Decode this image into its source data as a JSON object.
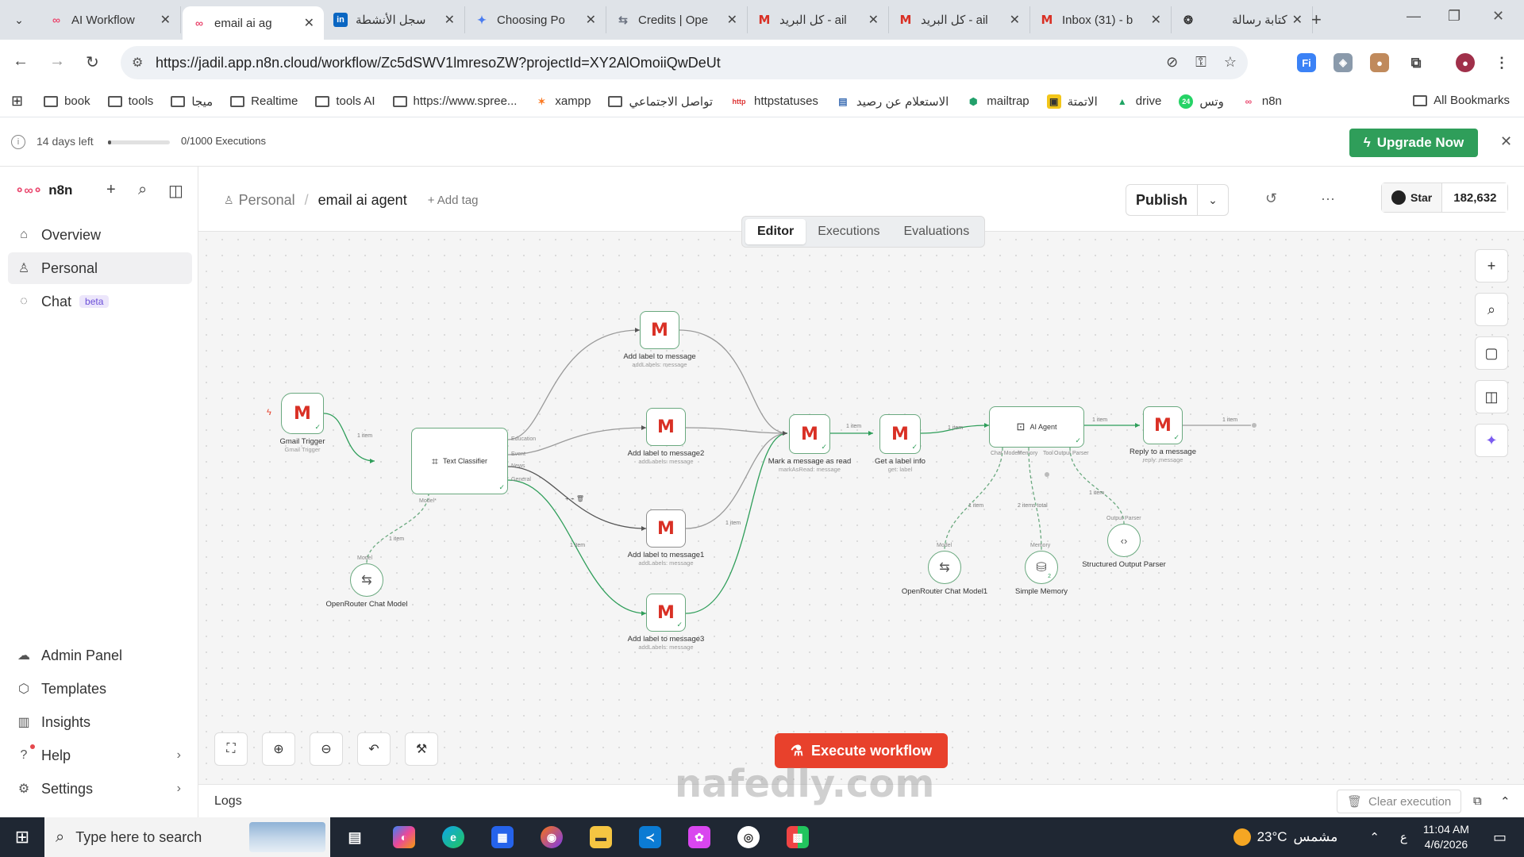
{
  "browser": {
    "tabs": [
      {
        "title": "AI Workflow",
        "icon": "n8n-icon",
        "active": false
      },
      {
        "title": "email ai ag",
        "icon": "n8n-icon",
        "active": true
      },
      {
        "title": "سجل الأنشطة",
        "icon": "linkedin-icon",
        "active": false
      },
      {
        "title": "Choosing Po",
        "icon": "gemini-icon",
        "active": false
      },
      {
        "title": "Credits | Ope",
        "icon": "openrouter-icon",
        "active": false
      },
      {
        "title": "كل البريد - ail",
        "icon": "gmail-icon",
        "active": false
      },
      {
        "title": "كل البريد - ail",
        "icon": "gmail-icon",
        "active": false
      },
      {
        "title": "Inbox (31) - b",
        "icon": "gmail-icon",
        "active": false
      },
      {
        "title": "كتابة رسالة",
        "icon": "chatgpt-icon",
        "active": false
      }
    ],
    "url": "https://jadil.app.n8n.cloud/workflow/Zc5dSWV1lmresoZW?projectId=XY2AlOmoiiQwDeUt",
    "bookmarks": [
      "book",
      "tools",
      "ميجا",
      "Realtime",
      "tools AI",
      "https://www.spree...",
      "xampp",
      "تواصل الاجتماعي",
      "httpstatuses",
      "الاستعلام عن رصيد",
      "mailtrap",
      "الاتمتة",
      "drive",
      "وتس",
      "n8n"
    ],
    "bookmark_icons": {
      "http": "http",
      "wts": "24"
    },
    "all_bookmarks": "All Bookmarks"
  },
  "trial": {
    "days_left": "14 days left",
    "progress": 0.05,
    "executions": "0/1000 Executions",
    "upgrade_label": "Upgrade Now"
  },
  "sidebar": {
    "brand": "n8n",
    "items_top": [
      {
        "label": "Overview",
        "icon": "home-icon"
      },
      {
        "label": "Personal",
        "icon": "user-icon",
        "active": true
      },
      {
        "label": "Chat",
        "icon": "chat-icon",
        "badge": "beta"
      }
    ],
    "items_bottom": [
      {
        "label": "Admin Panel",
        "icon": "cloud-icon"
      },
      {
        "label": "Templates",
        "icon": "box-icon"
      },
      {
        "label": "Insights",
        "icon": "chart-icon"
      },
      {
        "label": "Help",
        "icon": "help-icon"
      },
      {
        "label": "Settings",
        "icon": "settings-icon"
      }
    ]
  },
  "header": {
    "project": "Personal",
    "workflow_name": "email ai agent",
    "add_tag": "+ Add tag",
    "publish": "Publish",
    "star_label": "Star",
    "star_count": "182,632",
    "tabs": [
      "Editor",
      "Executions",
      "Evaluations"
    ],
    "active_tab": "Editor"
  },
  "canvas": {
    "nodes": {
      "gmail_trigger": {
        "label": "Gmail Trigger",
        "sub": "Gmail Trigger"
      },
      "text_classifier": {
        "label": "Text Classifier"
      },
      "openrouter_model": {
        "label": "OpenRouter Chat Model"
      },
      "add_label_1": {
        "label": "Add label to message",
        "sub": "addLabels: message"
      },
      "add_label_2": {
        "label": "Add label to message2",
        "sub": "addLabels: message"
      },
      "add_label_3": {
        "label": "Add label to message1",
        "sub": "addLabels: message"
      },
      "add_label_4": {
        "label": "Add label to message3",
        "sub": "addLabels: message"
      },
      "mark_read": {
        "label": "Mark a message as read",
        "sub": "markAsRead: message"
      },
      "get_label": {
        "label": "Get a label info",
        "sub": "get: label"
      },
      "ai_agent": {
        "label": "AI Agent"
      },
      "reply": {
        "label": "Reply to a message",
        "sub": "reply: message"
      },
      "openrouter_model_1": {
        "label": "OpenRouter Chat Model1"
      },
      "simple_memory": {
        "label": "Simple Memory"
      },
      "output_parser": {
        "label": "Structured Output Parser"
      }
    },
    "ports": {
      "education": "Education",
      "event": "Event",
      "news": "News",
      "general": "General",
      "model": "Model*",
      "agent_model": "Chat Model*",
      "agent_memory": "Memory",
      "agent_tool": "Tool",
      "agent_parser": "Output Parser",
      "model_in": "Model",
      "memory_in": "Memory",
      "parser_in": "Output Parser"
    },
    "edge_labels": {
      "one_item": "1 item",
      "two_items": "2 items total"
    },
    "memory_count": "2",
    "execute_label": "Execute workflow"
  },
  "logs": {
    "label": "Logs",
    "clear_label": "Clear execution"
  },
  "taskbar": {
    "search_placeholder": "Type here to search",
    "temperature": "23°C",
    "weather_text": "مشمس",
    "time": "11:04 AM",
    "date": "4/6/2026",
    "lang": "ع"
  },
  "watermark": "nafedly.com",
  "colors": {
    "accent": "#ea4b71",
    "execute": "#e8412c",
    "upgrade": "#2f9e5a",
    "success_edge": "#2f9e5a",
    "gmail": "#d93025"
  }
}
